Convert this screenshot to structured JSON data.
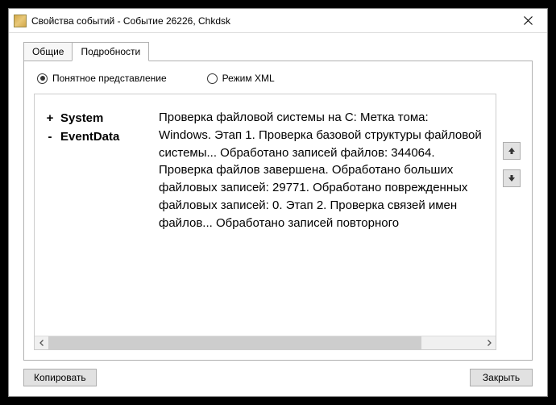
{
  "window": {
    "title": "Свойства событий - Событие 26226, Chkdsk"
  },
  "tabs": {
    "general": "Общие",
    "details": "Подробности"
  },
  "view_mode": {
    "friendly": "Понятное представление",
    "xml": "Режим XML",
    "selected": "friendly"
  },
  "tree": {
    "items": [
      {
        "sign": "+",
        "label": "System"
      },
      {
        "sign": "-",
        "label": "EventData"
      }
    ]
  },
  "detail_text": "Проверка файловой системы на C: Метка тома: Windows. Этап 1. Проверка базовой структуры файловой системы... Обработано записей файлов: 344064. Проверка файлов завершена. Обработано больших файловых записей: 29771. Обработано поврежденных файловых записей: 0. Этап 2. Проверка связей имен файлов... Обработано записей повторного",
  "buttons": {
    "copy": "Копировать",
    "close": "Закрыть"
  }
}
